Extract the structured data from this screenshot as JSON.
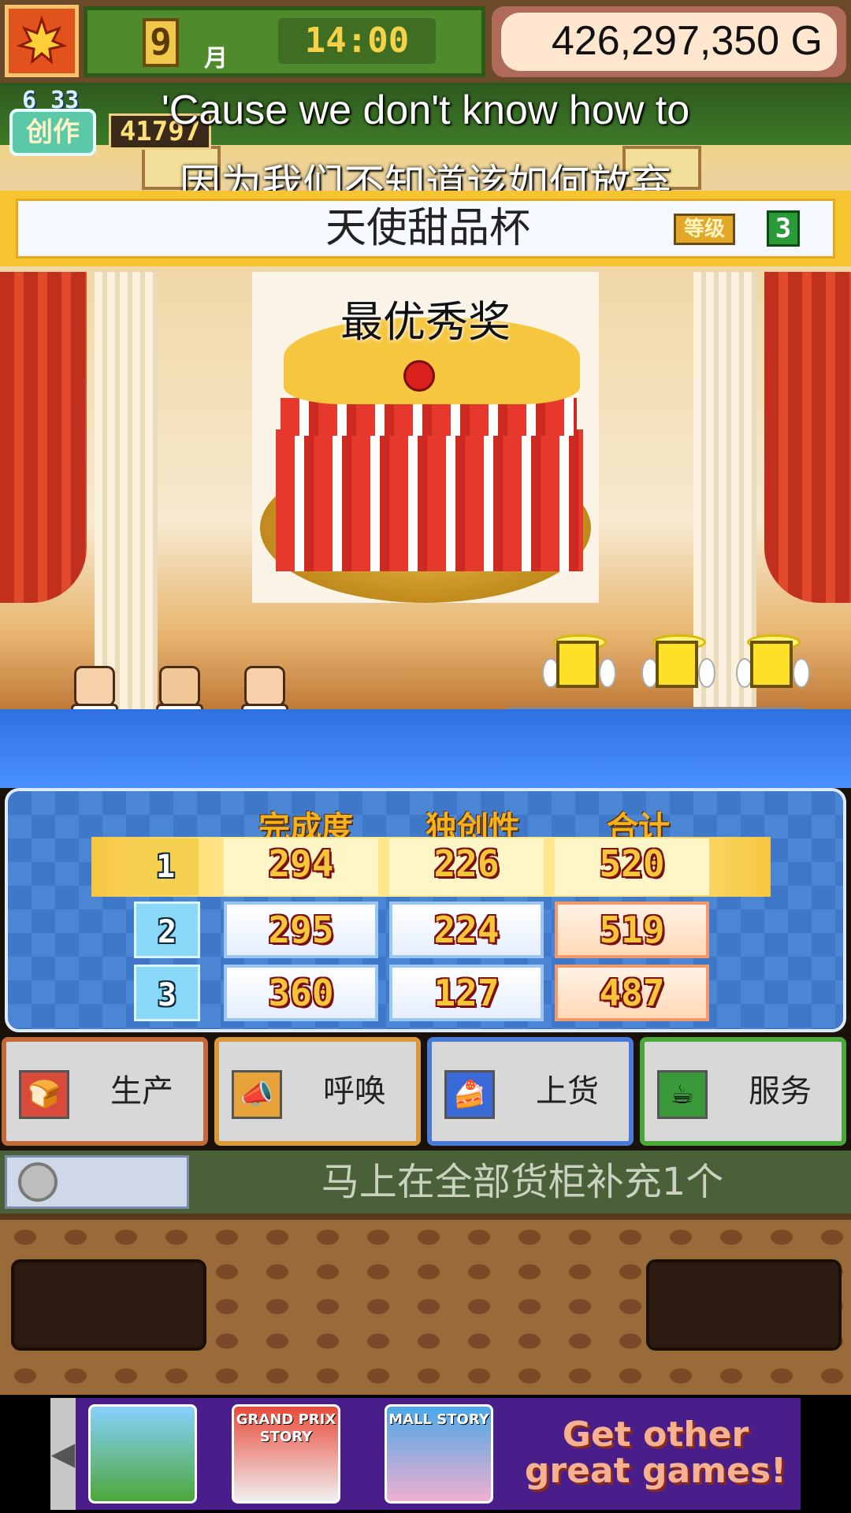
{
  "status_bar": {
    "month_number": "9",
    "month_label": "月",
    "time": "14:00",
    "money": "426,297,350 G"
  },
  "creation": {
    "date": "6 33",
    "badge_label": "创作",
    "points": "41797"
  },
  "subtitle": {
    "english": "'Cause we don't know how to",
    "chinese": "因为我们不知道该如何放弃"
  },
  "contest": {
    "name": "天使甜品杯",
    "rank_label": "等级",
    "rank_value": "3",
    "award": "最优秀奖"
  },
  "results": {
    "columns": [
      "完成度",
      "独创性",
      "合计"
    ],
    "rows": [
      {
        "rank": "1",
        "completion": "294",
        "originality": "226",
        "total": "520"
      },
      {
        "rank": "2",
        "completion": "295",
        "originality": "224",
        "total": "519"
      },
      {
        "rank": "3",
        "completion": "360",
        "originality": "127",
        "total": "487"
      }
    ]
  },
  "actions": [
    {
      "label": "生产",
      "icon": "bread-icon"
    },
    {
      "label": "呼唤",
      "icon": "megaphone-icon"
    },
    {
      "label": "上货",
      "icon": "cake-slice-icon"
    },
    {
      "label": "服务",
      "icon": "teapot-icon"
    }
  ],
  "quick_supply": {
    "text": "马上在全部货柜补充1个",
    "icon": "coin-icon"
  },
  "ad_banner": {
    "games": [
      "",
      "GRAND PRIX STORY",
      "MALL STORY"
    ],
    "cta": "Get other great games!"
  },
  "colors": {
    "accent_gold": "#f6c430",
    "panel_blue": "#3f78c8",
    "score_text": "#f6c63a"
  }
}
